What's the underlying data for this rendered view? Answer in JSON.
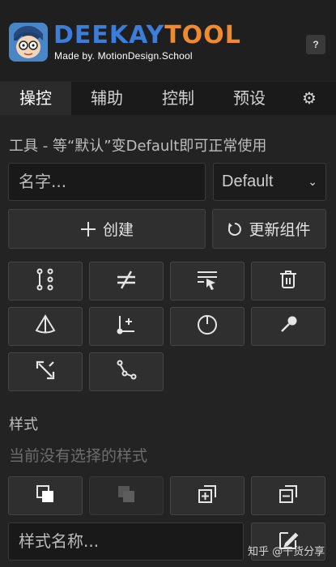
{
  "header": {
    "logo_deekay": "DEEKAY",
    "logo_tool": "TOOL",
    "made_by": "Made by. MotionDesign.School",
    "help_label": "?"
  },
  "tabs": [
    {
      "label": "操控",
      "active": true
    },
    {
      "label": "辅助",
      "active": false
    },
    {
      "label": "控制",
      "active": false
    },
    {
      "label": "预设",
      "active": false
    },
    {
      "label": "⚙",
      "active": false
    }
  ],
  "tools": {
    "hint": "工具 - 等“默认”变Default即可正常使用",
    "name_placeholder": "名字...",
    "preset_selected": "Default",
    "create_label": "创建",
    "update_label": "更新组件",
    "grid_icons": [
      "joint-chain-icon",
      "not-equal-icon",
      "select-list-icon",
      "trash-icon",
      "cone-light-icon",
      "add-bone-icon",
      "dial-icon",
      "pin-icon",
      "scale-diagonal-icon",
      "path-nodes-icon"
    ]
  },
  "styles": {
    "section_label": "样式",
    "empty_text": "当前没有选择的样式",
    "name_placeholder": "样式名称...",
    "grid_icons": [
      "copy-style-icon",
      "paste-style-icon",
      "add-layer-icon",
      "remove-layer-icon"
    ]
  },
  "watermark": "知乎 @干货分享",
  "colors": {
    "background": "#232323",
    "header_bg": "#1f1f1f",
    "button_bg": "#2f2f2f",
    "logo_blue": "#3b7dd8",
    "logo_orange": "#f08a2c"
  }
}
